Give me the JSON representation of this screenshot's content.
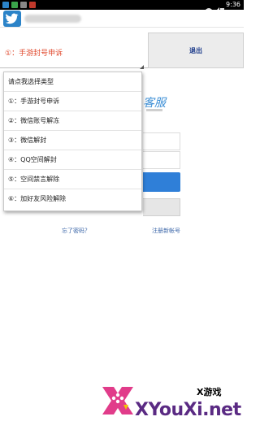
{
  "status_bar": {
    "time": "9:36"
  },
  "header": {
    "logo_icon": "twitter-bird-icon"
  },
  "selector": {
    "selected_value": "①：手游封号申诉",
    "logout_label": "退出"
  },
  "dropdown": {
    "header": "请点我选择类型",
    "items": [
      "①：手游封号申诉",
      "②：微信账号解冻",
      "③：微信解封",
      "④：QQ空间解封",
      "⑤：空间禁言解除",
      "⑥：加好友风险解除"
    ]
  },
  "login_page": {
    "service_label": "客服",
    "forgot_password": "忘了密码？",
    "register_link": "注册新帐号"
  },
  "watermark": {
    "sub": "X游戏",
    "main": "XYouXi.net"
  },
  "colors": {
    "accent_blue": "#2f7fd8",
    "selected_red": "#e04a2e",
    "link_blue": "#3b66a8",
    "watermark_purple": "#5a2a83"
  }
}
